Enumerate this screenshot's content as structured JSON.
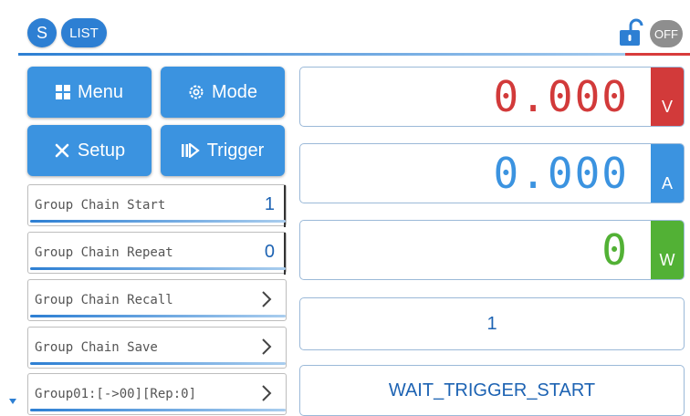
{
  "header": {
    "badges": [
      {
        "label": "S"
      },
      {
        "label": "LIST"
      }
    ],
    "lock_icon": "unlock-icon",
    "output_state": "OFF"
  },
  "buttons": {
    "menu": {
      "label": "Menu",
      "icon": "grid-icon"
    },
    "mode": {
      "label": "Mode",
      "icon": "gear-icon"
    },
    "setup": {
      "label": "Setup",
      "icon": "tools-icon"
    },
    "trigger": {
      "label": "Trigger",
      "icon": "play-pause-icon"
    }
  },
  "list_rows": [
    {
      "label": "Group Chain Start",
      "value": "1"
    },
    {
      "label": "Group Chain Repeat",
      "value": "0"
    },
    {
      "label": "Group Chain Recall"
    },
    {
      "label": "Group Chain Save"
    },
    {
      "label": "Group01:[->00][Rep:0]"
    }
  ],
  "readouts": {
    "voltage": {
      "value": "0.000",
      "unit": "V",
      "color": "#d23a3a"
    },
    "current": {
      "value": "0.000",
      "unit": "A",
      "color": "#3b93e0"
    },
    "power": {
      "value": "0",
      "unit": "W",
      "color": "#52b135"
    }
  },
  "step_display": "1",
  "status_display": "WAIT_TRIGGER_START",
  "colors": {
    "accent_blue": "#3b93e0",
    "voltage_red": "#d23a3a",
    "power_green": "#52b135",
    "off_gray": "#8e8e8e"
  }
}
